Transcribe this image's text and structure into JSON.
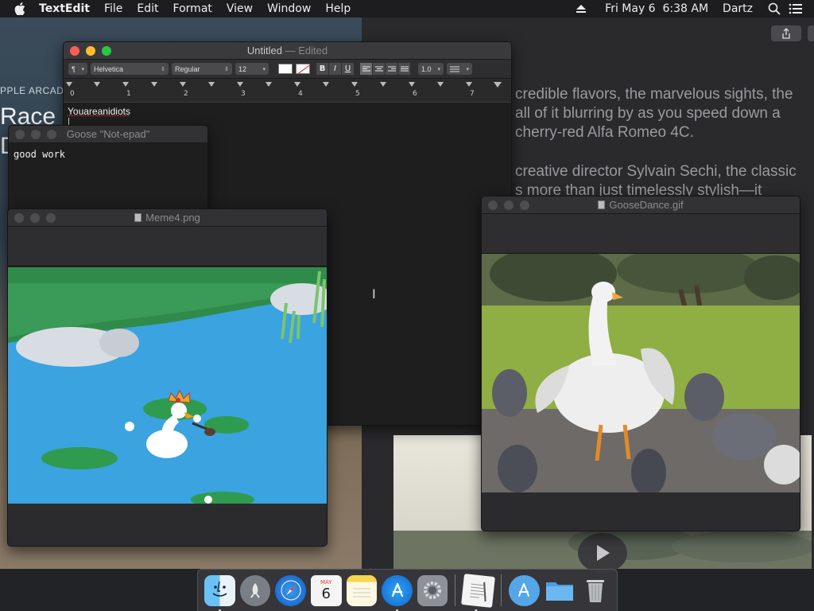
{
  "menubar": {
    "app_name": "TextEdit",
    "menus": [
      "File",
      "Edit",
      "Format",
      "View",
      "Window",
      "Help"
    ],
    "datetime": "Fri May 6  6:38 AM",
    "user": "Dartz"
  },
  "background_article": {
    "kicker": "PPLE ARCAD",
    "title": "Race a",
    "title_line2": "D",
    "lines": [
      "credible flavors, the marvelous sights, the",
      "all of it blurring by as you speed down a",
      "cherry-red Alfa Romeo 4C.",
      "creative director Sylvain Sechi, the classic",
      "s more than just timelessly stylish—it"
    ]
  },
  "textedit": {
    "title": "Untitled",
    "title_suffix": "— Edited",
    "paragraph_style": "¶",
    "font_family": "Helvetica",
    "font_style": "Regular",
    "font_size": "12",
    "bold": "B",
    "italic": "I",
    "underline": "U",
    "line_spacing": "1.0",
    "ruler_numbers": [
      "0",
      "1",
      "2",
      "3",
      "4",
      "5",
      "6",
      "7"
    ],
    "content": "Youareanidiots"
  },
  "notepad": {
    "title": "Goose \"Not-epad\"",
    "content": "good work"
  },
  "meme_window": {
    "title": "Meme4.png"
  },
  "gif_window": {
    "title": "GooseDance.gif"
  },
  "dock": {
    "items": [
      "finder-icon",
      "launchpad-icon",
      "safari-icon",
      "calendar-icon",
      "notes-icon",
      "app-store-icon",
      "system-preferences-icon",
      "textedit-icon",
      "applications-folder-icon",
      "documents-folder-icon",
      "trash-icon"
    ],
    "calendar_month": "MAY",
    "calendar_day": "6"
  },
  "colors": {
    "close": "#fe5f57",
    "minimize": "#febc2e",
    "zoom": "#28c840",
    "menubar_bg": "#1d1d1f"
  }
}
